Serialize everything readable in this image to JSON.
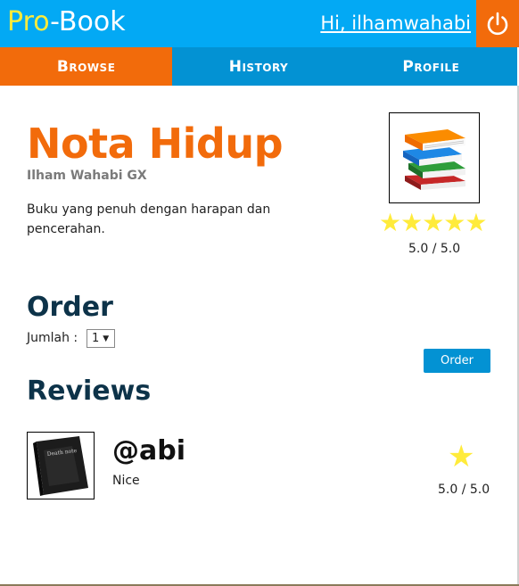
{
  "header": {
    "logo_pro": "Pro",
    "logo_sep": "-",
    "logo_book": "Book",
    "greeting": "Hi, ilhamwahabi",
    "logout_icon": "power-icon"
  },
  "nav": {
    "tabs": [
      {
        "label": "Browse",
        "active": true
      },
      {
        "label": "History",
        "active": false
      },
      {
        "label": "Profile",
        "active": false
      }
    ]
  },
  "book": {
    "title": "Nota Hidup",
    "author": "Ilham Wahabi GX",
    "description": "Buku yang penuh dengan harapan dan pencerahan.",
    "cover_icon": "books-stack-icon",
    "stars": "★★★★★",
    "rating_text": "5.0 / 5.0",
    "rating_value": 5.0
  },
  "order": {
    "heading": "Order",
    "quantity_label": "Jumlah :",
    "quantity_value": "1",
    "order_button": "Order"
  },
  "reviews": {
    "heading": "Reviews",
    "items": [
      {
        "user": "@abi",
        "text": "Nice",
        "star": "★",
        "rating_text": "5.0 / 5.0",
        "rating_value": 5.0,
        "avatar_icon": "death-note-book-icon"
      }
    ]
  },
  "colors": {
    "primary_blue": "#03a9f4",
    "nav_blue": "#0392d3",
    "accent_orange": "#f26b0b",
    "logo_yellow": "#ffeb3b",
    "star_yellow": "#ffeb3b",
    "heading_navy": "#0d3349"
  }
}
